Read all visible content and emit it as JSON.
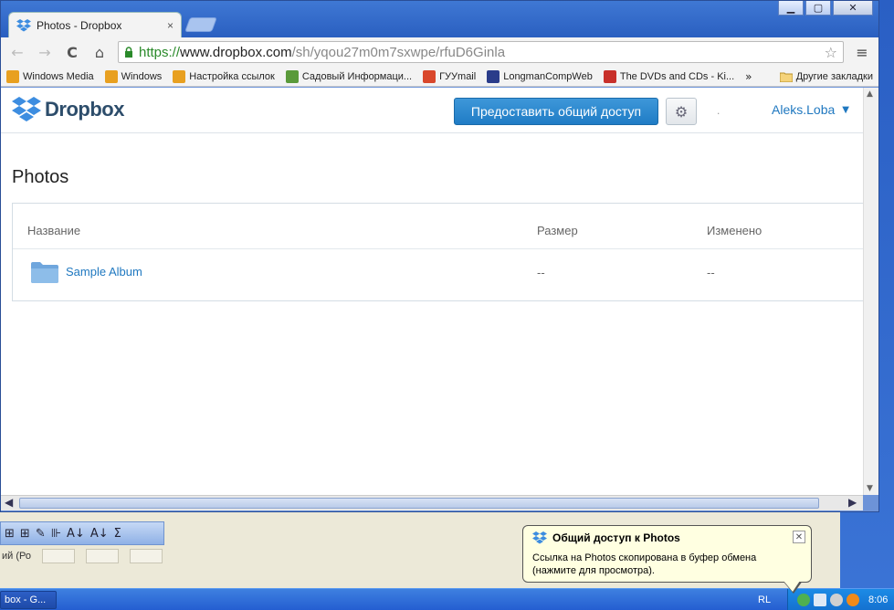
{
  "window": {
    "tab_title": "Photos - Dropbox",
    "tab_close": "×",
    "controls": {
      "minimize": "▁",
      "maximize": "▢",
      "close": "✕"
    }
  },
  "toolbar": {
    "back": "←",
    "forward": "→",
    "reload": "C",
    "home": "⌂",
    "url_proto": "https://",
    "url_host": "www.dropbox.com",
    "url_path": "/sh/yqou27m0m7sxwpe/rfuD6Ginla",
    "star": "☆",
    "menu": "≡"
  },
  "bookmarks": [
    {
      "label": "Windows Media",
      "color": "#e8a020"
    },
    {
      "label": "Windows",
      "color": "#e8a020"
    },
    {
      "label": "Настройка ссылок",
      "color": "#e8a020"
    },
    {
      "label": "Садовый Информаци...",
      "color": "#5a9a3a"
    },
    {
      "label": "ГУУmail",
      "color": "#d9472b"
    },
    {
      "label": "LongmanCompWeb",
      "color": "#2a3c8a"
    },
    {
      "label": "The DVDs and CDs - Ki...",
      "color": "#c8302a"
    }
  ],
  "bookmarks_more": "»",
  "bookmarks_folder": "Другие закладки",
  "dropbox": {
    "logo_text": "Dropbox",
    "share_button": "Предоставить общий доступ",
    "settings_icon": "⚙",
    "dot": ".",
    "account_name": "Aleks.Loba",
    "account_caret": "▼"
  },
  "page": {
    "title": "Photos",
    "columns": {
      "name": "Название",
      "size": "Размер",
      "modified": "Изменено"
    },
    "rows": [
      {
        "name": "Sample Album",
        "size": "--",
        "modified": "--"
      }
    ]
  },
  "background_app": {
    "toolbar_glyphs": [
      "⊞",
      "⊞",
      "✎",
      "⊪",
      "A↓",
      "A↓",
      "Σ"
    ],
    "row_text": "ий (Ро"
  },
  "taskbar": {
    "task_label": "box - G...",
    "lang": "RL",
    "clock": "8:06"
  },
  "balloon": {
    "title": "Общий доступ к Photos",
    "text": "Ссылка на Photos скопирована в буфер обмена (нажмите для просмотра).",
    "close": "✕"
  },
  "colors": {
    "accent": "#1f78c0",
    "share_button": "#2a87cf",
    "folder": "#7fb3e8"
  }
}
